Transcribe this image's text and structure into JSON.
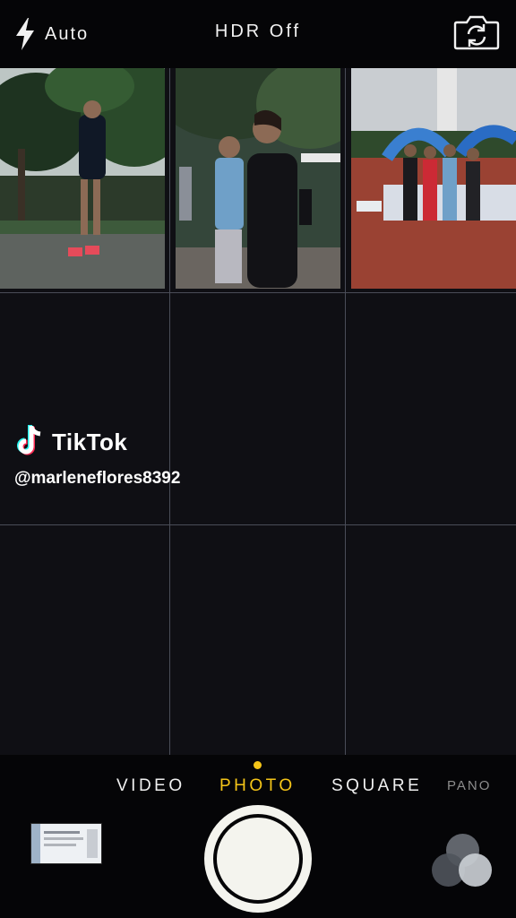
{
  "top_bar": {
    "flash_label": "Auto",
    "hdr_label": "HDR Off"
  },
  "overlay": {
    "brand": "TikTok",
    "username": "@marleneflores8392"
  },
  "modes": {
    "video": "VIDEO",
    "photo": "PHOTO",
    "square": "SQUARE",
    "pano": "PANO"
  },
  "colors": {
    "accent_yellow": "#f5c518",
    "background": "#0b0b0f"
  },
  "icons": [
    "flash-icon",
    "camera-switch-icon",
    "tiktok-logo-icon",
    "shutter-button",
    "filters-icon"
  ]
}
